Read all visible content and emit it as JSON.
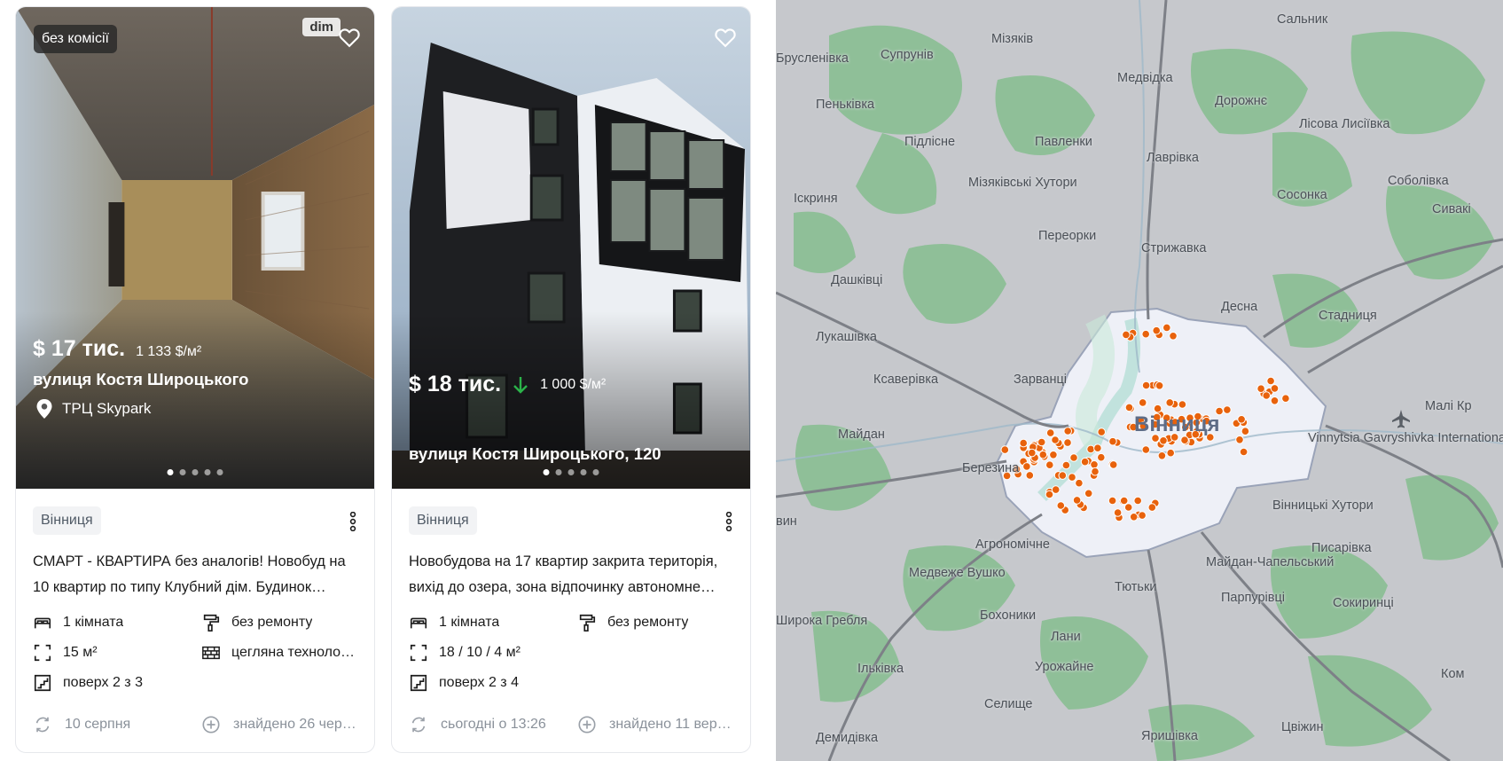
{
  "listings": [
    {
      "badge": "без комісії",
      "brand": "dim",
      "price": "$ 17 тис.",
      "price_per_m2": "1 133 $/м²",
      "address": "вулиця Костя Широцького",
      "landmark": "ТРЦ Skypark",
      "city": "Вінниця",
      "description": "СМАРТ - КВАРТИРА без аналогів! Новобуд на 10 квартир по типу Клубний дім. Будинок…",
      "features": {
        "rooms": "1 кімната",
        "repair": "без ремонту",
        "area": "15 м²",
        "wall": "цегляна техноло…",
        "floor": "поверх 2 з 3"
      },
      "updated": "10 серпня",
      "found": "знайдено 26 чер…",
      "slides": 5,
      "active_slide": 1
    },
    {
      "price": "$ 18 тис.",
      "price_trend": "down",
      "price_per_m2": "1 000 $/м²",
      "address": "вулиця Костя Широцького, 120",
      "city": "Вінниця",
      "description": "Новобудова на 17 квартир закрита територія, вихід до озера, зона відпочинку автономне…",
      "features": {
        "rooms": "1 кімната",
        "repair": "без ремонту",
        "area": "18 / 10 / 4 м²",
        "floor": "поверх 2 з 4"
      },
      "updated": "сьогодні о 13:26",
      "found": "знайдено 11 вер…",
      "slides": 5,
      "active_slide": 1
    }
  ],
  "icons": {
    "favorite": "heart-outline-icon",
    "menu": "kebab-menu-icon",
    "rooms": "bed-icon",
    "repair": "paint-roller-icon",
    "area": "area-frame-icon",
    "wall": "brick-wall-icon",
    "floor": "stairs-icon",
    "updated": "refresh-icon",
    "found": "plus-circle-icon",
    "location": "location-pin-icon",
    "price_down": "arrow-down-icon",
    "airport": "airplane-icon"
  },
  "colors": {
    "accent_marker": "#e8620c",
    "price_down": "#2bb34a",
    "chip_bg": "#f2f3f5",
    "map_land": "#c6c8cc",
    "map_forest": "#8fbf98",
    "map_city": "#eef0f7"
  },
  "map": {
    "city_name": "Вінниця",
    "places": [
      "Сальник",
      "Брусленівка",
      "Супрунів",
      "Мізяків",
      "Медвідка",
      "Пеньківка",
      "Дорожнє",
      "Лісова Лисіївка",
      "Підлісне",
      "Павленки",
      "Лаврівка",
      "Соболівка",
      "Іскриня",
      "Мізяківські Хутори",
      "Сосонка",
      "Сивакі",
      "Переорки",
      "Стрижавка",
      "Дашківці",
      "Лукашівка",
      "Десна",
      "Стадниця",
      "Ксаверівка",
      "Зарванці",
      "Малі Кр",
      "Майдан",
      "Березина",
      "Vinnytsia Gavryshivka International Airport",
      "Вінницькі Хутори",
      "Агрономічне",
      "Майдан-Чапельський",
      "Писарівка",
      "Медвеже Вушко",
      "Тютьки",
      "Бохоники",
      "Парпурівці",
      "Сокиринці",
      "Широка Гребля",
      "Лани",
      "Ільківка",
      "Урожайне",
      "Селище",
      "Цвіжин",
      "Ком",
      "Демидівка",
      "Яришівка",
      "вин"
    ]
  }
}
